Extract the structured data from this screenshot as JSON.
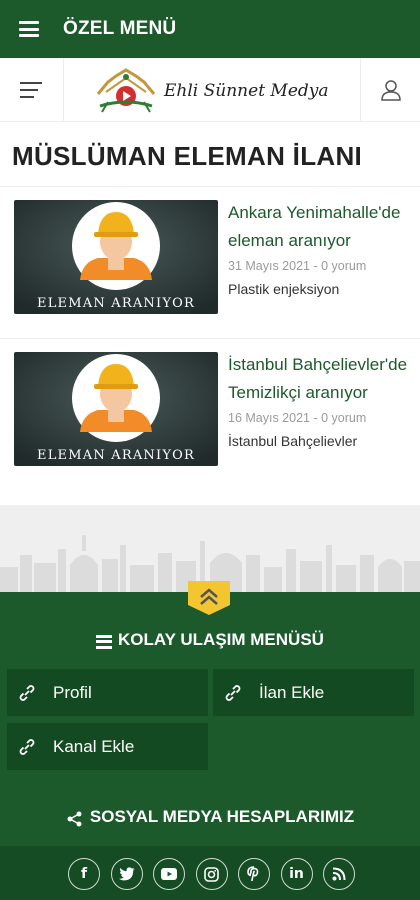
{
  "topbar": {
    "title": "ÖZEL MENÜ"
  },
  "brand": {
    "logo_text": "Ehli Sünnet Medya"
  },
  "page": {
    "title": "MÜSLÜMAN ELEMAN İLANI"
  },
  "posts": [
    {
      "title": "Ankara Yenimahalle'de eleman aranıyor",
      "meta": "31 Mayıs 2021 - 0 yorum",
      "excerpt": "Plastik enjeksiyon",
      "thumb_caption": "ELEMAN ARANIYOR"
    },
    {
      "title": "İstanbul Bahçelievler'de Temizlikçi aranıyor",
      "meta": "16 Mayıs 2021 - 0 yorum",
      "excerpt": "İstanbul Bahçelievler",
      "thumb_caption": "ELEMAN ARANIYOR"
    }
  ],
  "footer": {
    "menu_title": "KOLAY ULAŞIM MENÜSÜ",
    "links": [
      "Profil",
      "İlan Ekle",
      "Kanal Ekle"
    ],
    "social_title": "SOSYAL MEDYA HESAPLARIMIZ",
    "social_icons": [
      "facebook-icon",
      "twitter-icon",
      "youtube-icon",
      "instagram-icon",
      "pinterest-icon",
      "linkedin-icon",
      "rss-icon"
    ]
  },
  "colors": {
    "primary": "#1c5a2c",
    "dark": "#144a22",
    "link": "#1c5a2c",
    "accent": "#f2c531"
  }
}
